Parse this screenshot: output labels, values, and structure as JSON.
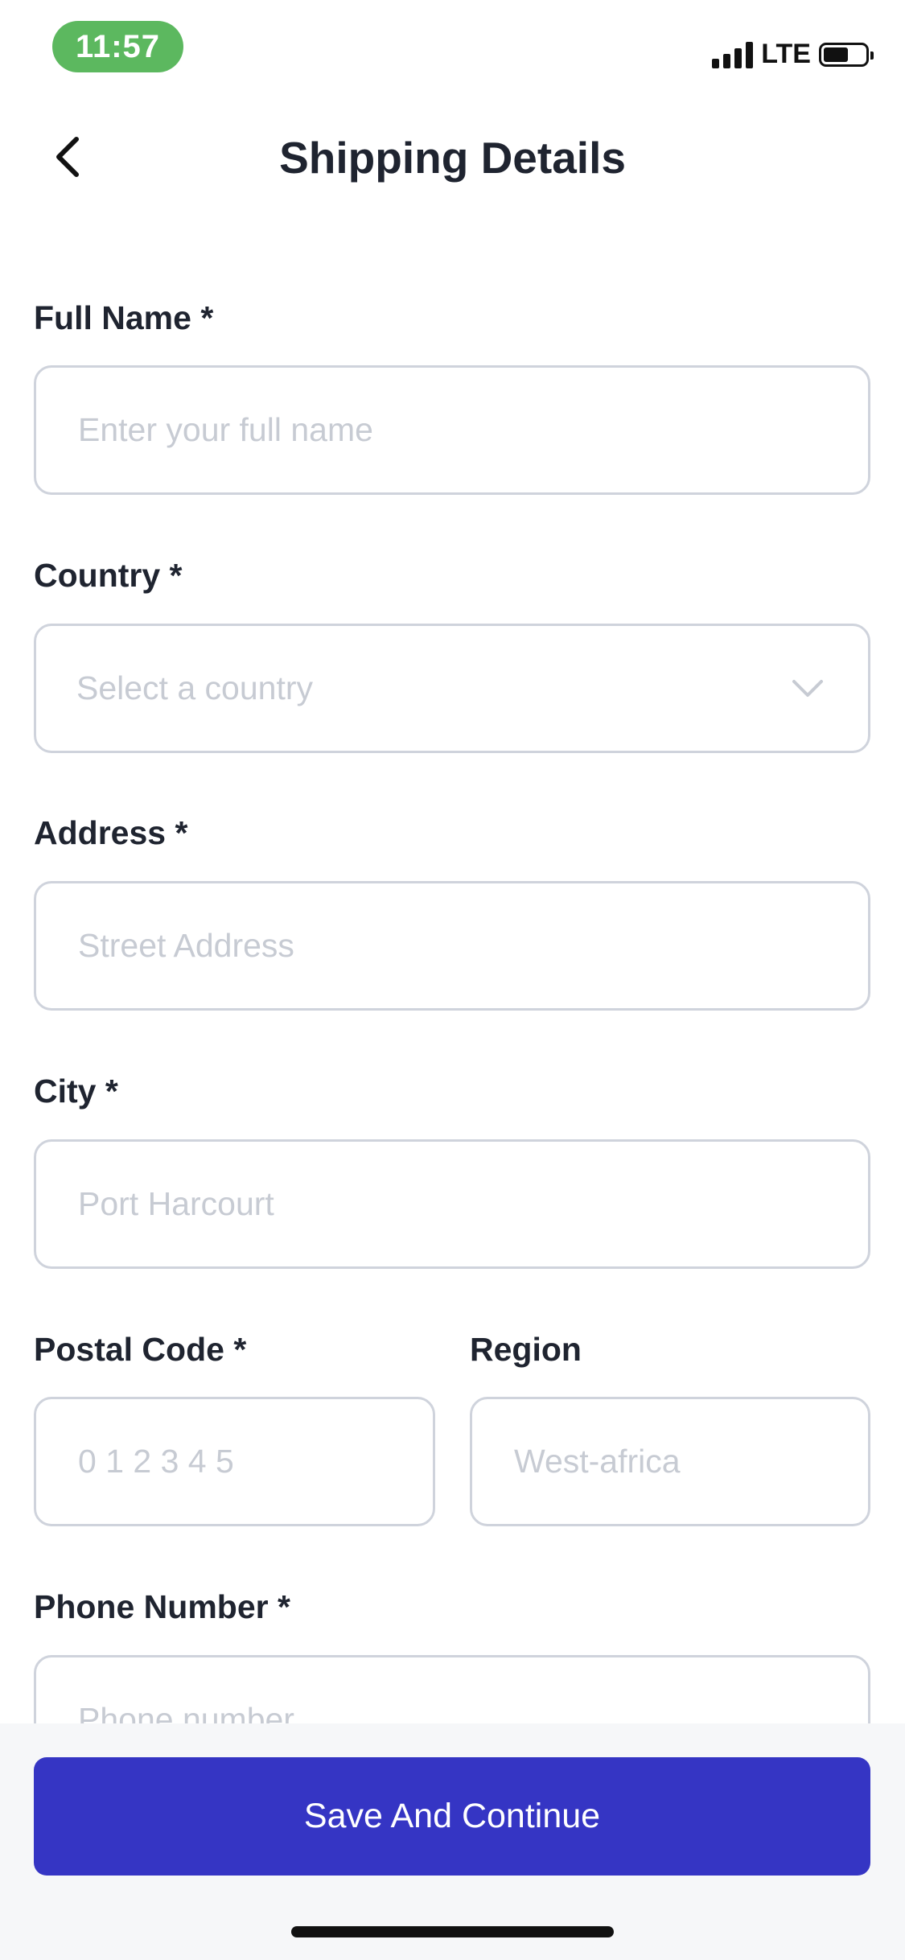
{
  "status_bar": {
    "time": "11:57",
    "network": "LTE"
  },
  "header": {
    "title": "Shipping Details"
  },
  "form": {
    "full_name": {
      "label": "Full Name *",
      "placeholder": "Enter your full name"
    },
    "country": {
      "label": "Country *",
      "placeholder": "Select a country"
    },
    "address": {
      "label": "Address *",
      "placeholder": "Street Address"
    },
    "city": {
      "label": "City *",
      "placeholder": "Port Harcourt"
    },
    "postal_code": {
      "label": "Postal Code *",
      "placeholder": "0 1 2 3 4 5"
    },
    "region": {
      "label": "Region",
      "placeholder": "West-africa"
    },
    "phone": {
      "label": "Phone Number *",
      "placeholder": "Phone number"
    }
  },
  "actions": {
    "save_label": "Save And Continue"
  },
  "colors": {
    "primary": "#3535c4",
    "time_pill": "#5cb85f",
    "field_border": "#cfd3dc",
    "placeholder": "#c7cbd3"
  },
  "icons": [
    "back-chevron-icon",
    "dropdown-chevron-icon",
    "signal-icon",
    "battery-icon"
  ]
}
